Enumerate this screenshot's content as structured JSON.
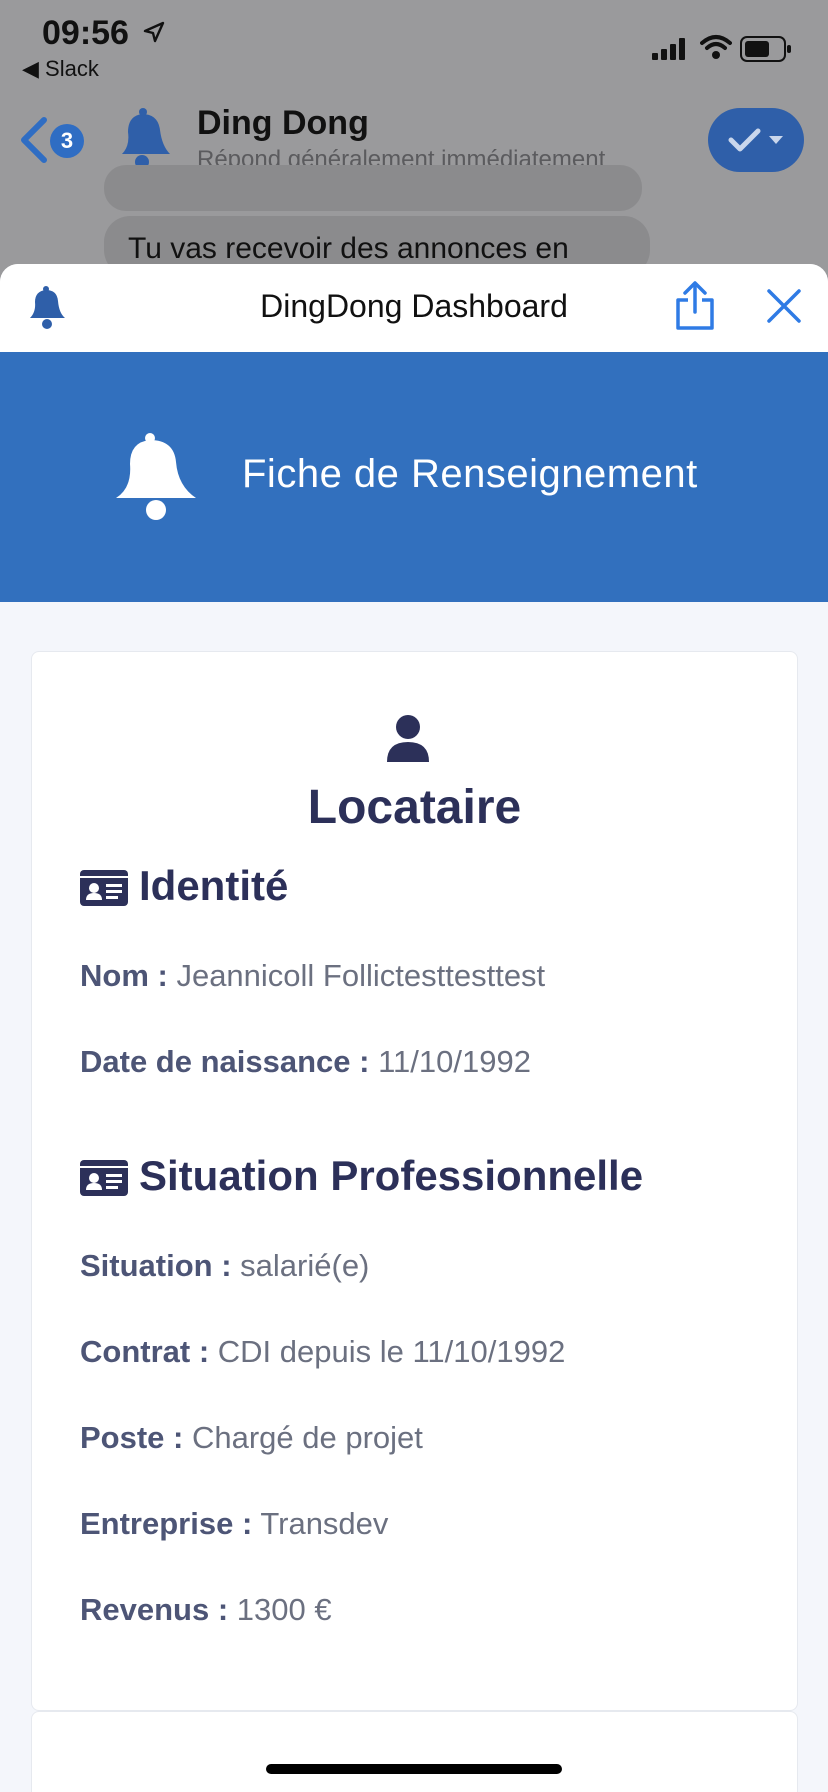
{
  "status_bar": {
    "time": "09:56",
    "back_app": "◀ Slack"
  },
  "chat": {
    "unread_count": "3",
    "name": "Ding Dong",
    "status": "Répond généralement immédiatement",
    "message_preview": "Tu vas recevoir des annonces en"
  },
  "sheet": {
    "title": "DingDong Dashboard"
  },
  "banner": {
    "title": "Fiche de Renseignement"
  },
  "card": {
    "title": "Locataire",
    "sections": [
      {
        "title": "Identité",
        "fields": [
          {
            "label": "Nom :",
            "value": "Jeannicoll Follictesttesttest"
          },
          {
            "label": "Date de naissance :",
            "value": "11/10/1992"
          }
        ]
      },
      {
        "title": "Situation Professionnelle",
        "fields": [
          {
            "label": "Situation :",
            "value": "salarié(e)"
          },
          {
            "label": "Contrat :",
            "value": "CDI depuis le 11/10/1992"
          },
          {
            "label": "Poste :",
            "value": "Chargé de projet"
          },
          {
            "label": "Entreprise :",
            "value": "Transdev"
          },
          {
            "label": "Revenus :",
            "value": "1300 €"
          }
        ]
      }
    ]
  },
  "colors": {
    "accent": "#3270be",
    "text_dark": "#2c3059",
    "label": "#4d5576"
  }
}
